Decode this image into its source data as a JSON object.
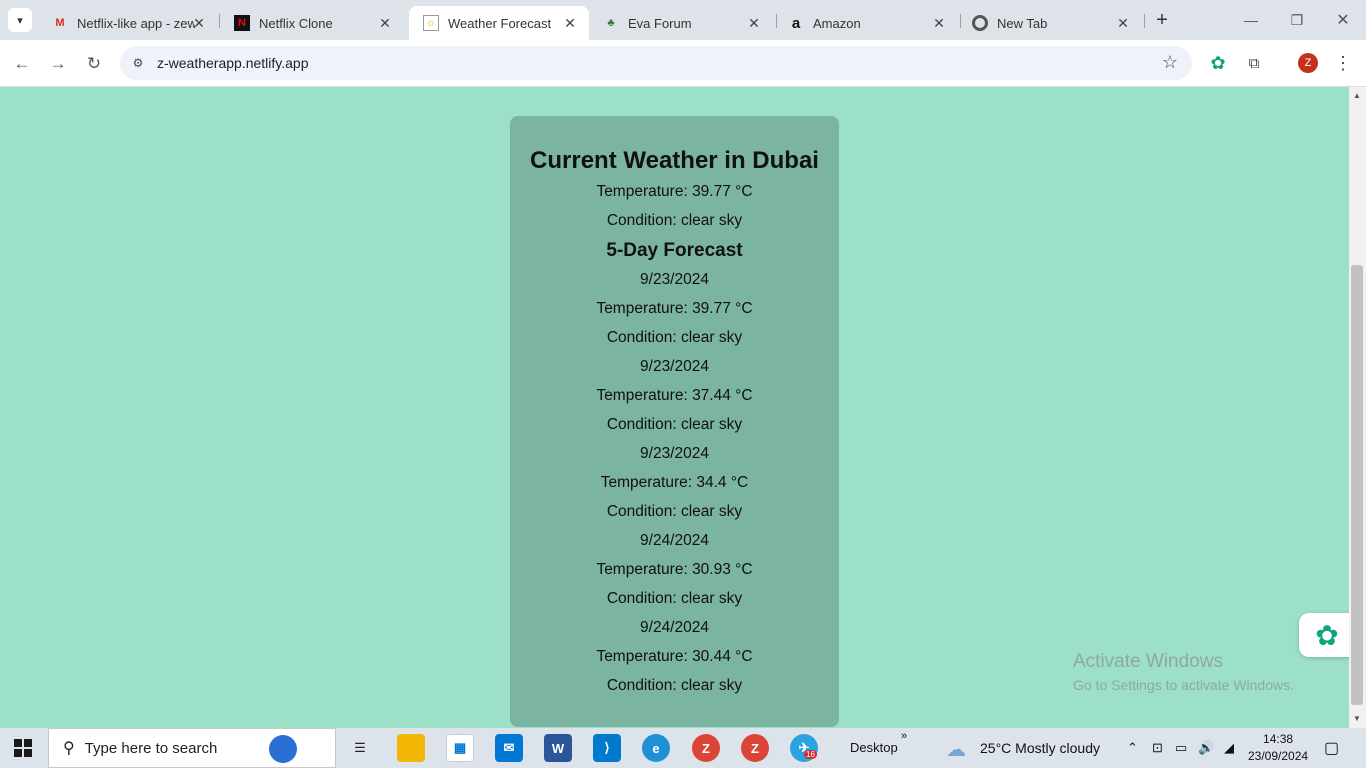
{
  "browser": {
    "tabs": [
      {
        "title": "Netflix-like app - zew",
        "favicon": "gmail-icon",
        "active": false
      },
      {
        "title": "Netflix Clone",
        "favicon": "netflix-icon",
        "active": false
      },
      {
        "title": "Weather Forecast",
        "favicon": "weather-icon",
        "active": true
      },
      {
        "title": "Eva Forum",
        "favicon": "forum-icon",
        "active": false
      },
      {
        "title": "Amazon",
        "favicon": "amazon-icon",
        "active": false
      },
      {
        "title": "New Tab",
        "favicon": "chrome-icon",
        "active": false
      }
    ],
    "url": "z-weatherapp.netlify.app",
    "profile_initial": "Z"
  },
  "weather": {
    "heading": "Current Weather in Dubai",
    "current_temp": "Temperature: 39.77 °C",
    "current_condition": "Condition: clear sky",
    "forecast_heading": "5-Day Forecast",
    "forecast": [
      {
        "date": "9/23/2024",
        "temp": "Temperature: 39.77 °C",
        "condition": "Condition: clear sky"
      },
      {
        "date": "9/23/2024",
        "temp": "Temperature: 37.44 °C",
        "condition": "Condition: clear sky"
      },
      {
        "date": "9/23/2024",
        "temp": "Temperature: 34.4 °C",
        "condition": "Condition: clear sky"
      },
      {
        "date": "9/24/2024",
        "temp": "Temperature: 30.93 °C",
        "condition": "Condition: clear sky"
      },
      {
        "date": "9/24/2024",
        "temp": "Temperature: 30.44 °C",
        "condition": "Condition: clear sky"
      }
    ]
  },
  "watermark": {
    "line1": "Activate Windows",
    "line2": "Go to Settings to activate Windows."
  },
  "taskbar": {
    "search_placeholder": "Type here to search",
    "desktop_label": "Desktop",
    "weather": "25°C  Mostly cloudy",
    "time": "14:38",
    "date": "23/09/2024",
    "badge_count": "16"
  },
  "colors": {
    "page_bg": "#9be0c7",
    "card_bg": "#7bb4a0"
  }
}
